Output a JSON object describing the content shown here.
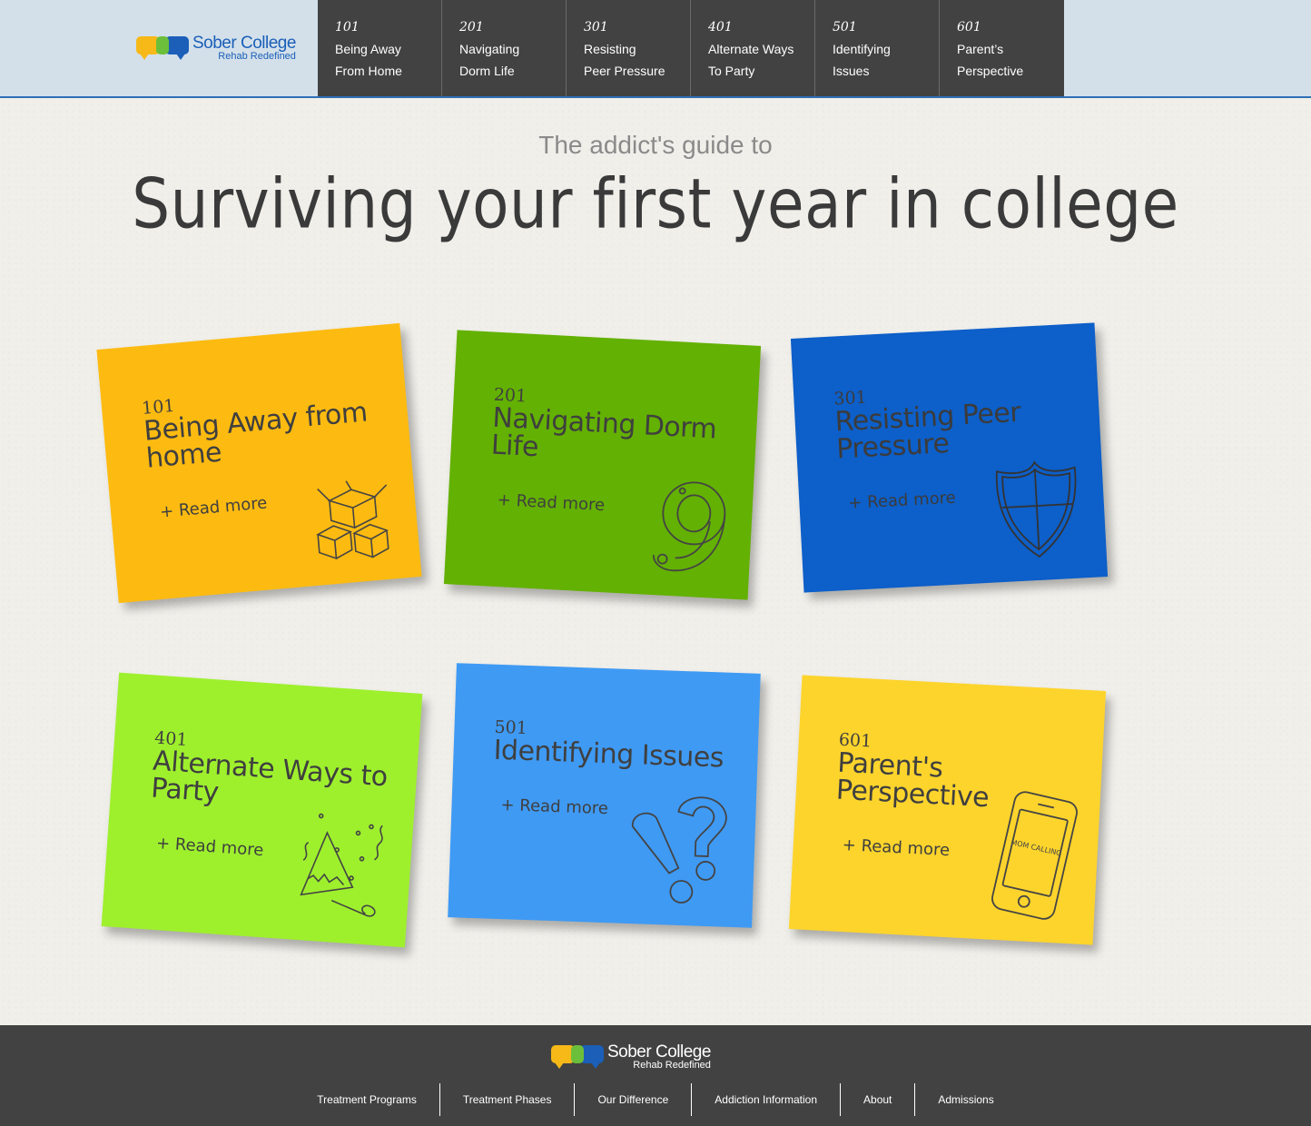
{
  "brand": {
    "name": "Sober College",
    "tagline": "Rehab Redefined",
    "colors": {
      "yellow": "#f6b918",
      "green": "#6cbf3a",
      "blue": "#1b5fb8"
    }
  },
  "nav": {
    "items": [
      {
        "num": "101",
        "line1": "Being Away",
        "line2": "From Home"
      },
      {
        "num": "201",
        "line1": "Navigating",
        "line2": "Dorm Life"
      },
      {
        "num": "301",
        "line1": "Resisting",
        "line2": "Peer Pressure"
      },
      {
        "num": "401",
        "line1": "Alternate Ways",
        "line2": "To Party"
      },
      {
        "num": "501",
        "line1": "Identifying",
        "line2": "Issues"
      },
      {
        "num": "601",
        "line1": "Parent’s",
        "line2": "Perspective"
      }
    ]
  },
  "hero": {
    "subtitle": "The addict's guide to",
    "title": "Surviving your first year in college"
  },
  "notes": [
    {
      "num": "101",
      "title": "Being Away from home",
      "more": "+ Read more",
      "color": "#fdbb11",
      "icon": "boxes-icon"
    },
    {
      "num": "201",
      "title": "Navigating Dorm Life",
      "more": "+ Read more",
      "color": "#63b102",
      "icon": "number-nine-icon"
    },
    {
      "num": "301",
      "title": "Resisting Peer Pressure",
      "more": "+ Read more",
      "color": "#0d5fc9",
      "icon": "shield-icon"
    },
    {
      "num": "401",
      "title": "Alternate Ways to Party",
      "more": "+ Read more",
      "color": "#9ef02d",
      "icon": "party-hat-icon"
    },
    {
      "num": "501",
      "title": "Identifying Issues",
      "more": "+ Read more",
      "color": "#3f9af4",
      "icon": "exclamation-question-icon"
    },
    {
      "num": "601",
      "title": "Parent's Perspective",
      "more": "+ Read more",
      "color": "#fdd42c",
      "icon": "phone-icon",
      "phone_text": "MOM CALLING"
    }
  ],
  "footer": {
    "links": [
      "Treatment Programs",
      "Treatment Phases",
      "Our Difference",
      "Addiction Information",
      "About",
      "Admissions"
    ]
  }
}
